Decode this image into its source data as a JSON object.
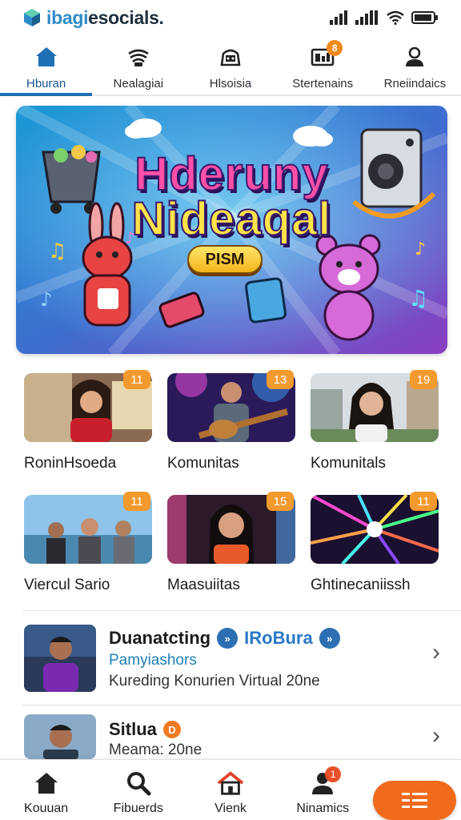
{
  "app": {
    "brand_part1": "ibagi",
    "brand_part2": "esocials."
  },
  "top_tabs": [
    {
      "label": "Hburan",
      "icon": "home-icon",
      "active": true
    },
    {
      "label": "Nealagiai",
      "icon": "radio-icon"
    },
    {
      "label": "Hlsoisia",
      "icon": "gamepad-icon"
    },
    {
      "label": "Stertenains",
      "icon": "video-icon",
      "badge": "8"
    },
    {
      "label": "Rneiindaics",
      "icon": "person-icon"
    }
  ],
  "banner": {
    "line1": "Hderuny",
    "line2": "Nideaqal",
    "button": "PISM"
  },
  "cards": [
    {
      "label": "RoninHsoeda",
      "count": "11"
    },
    {
      "label": "Komunitas",
      "count": "13"
    },
    {
      "label": "Komunitals",
      "count": "19"
    },
    {
      "label": "Viercul Sario",
      "count": "11"
    },
    {
      "label": "Maasuiitas",
      "count": "15"
    },
    {
      "label": "Ghtinecaniissh",
      "count": "11"
    }
  ],
  "list": [
    {
      "title": "Duanatcting",
      "tag": "IRoBura",
      "subtitle": "Pamyiashors",
      "desc": "Kureding Konurien Virtual 20ne"
    },
    {
      "title": "Sitlua",
      "badge": "D",
      "desc": "Meama: 20ne"
    }
  ],
  "bottom_nav": [
    {
      "label": "Kouuan",
      "icon": "home-icon"
    },
    {
      "label": "Fibuerds",
      "icon": "search-icon"
    },
    {
      "label": "Vienk",
      "icon": "house-icon"
    },
    {
      "label": "Ninamics",
      "icon": "profile-icon",
      "badge": "1"
    }
  ],
  "colors": {
    "accent": "#1f6fb5",
    "orange": "#f26a1b",
    "badge": "#f39a2e"
  }
}
